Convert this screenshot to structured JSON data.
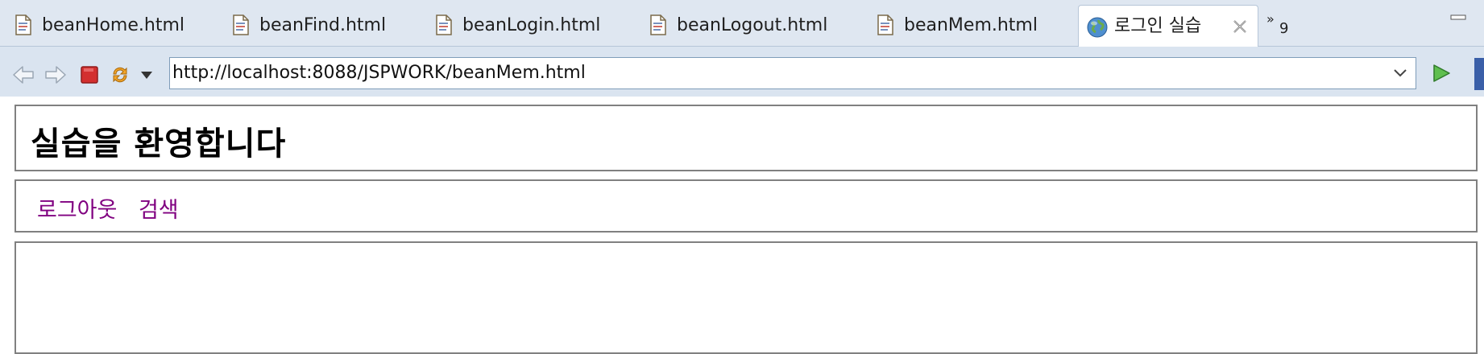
{
  "tabs": [
    {
      "label": "beanHome.html",
      "icon": "html-file-icon"
    },
    {
      "label": "beanFind.html",
      "icon": "html-file-icon"
    },
    {
      "label": "beanLogin.html",
      "icon": "html-file-icon"
    },
    {
      "label": "beanLogout.html",
      "icon": "html-file-icon"
    },
    {
      "label": "beanMem.html",
      "icon": "html-file-icon"
    },
    {
      "label": "로그인 실습",
      "icon": "globe-icon",
      "active": true
    }
  ],
  "overflow": {
    "symbol": "»",
    "count": "9"
  },
  "toolbar": {
    "url": "http://localhost:8088/JSPWORK/beanMem.html"
  },
  "page": {
    "heading": "실습을 환영합니다",
    "nav": [
      {
        "label": "로그아웃"
      },
      {
        "label": "검색"
      }
    ]
  },
  "colors": {
    "tabbar_bg": "#dfe7f1",
    "toolbar_bg": "#dae4f0",
    "link": "#800080",
    "stop": "#d32f2f",
    "go": "#3a9a3a"
  }
}
